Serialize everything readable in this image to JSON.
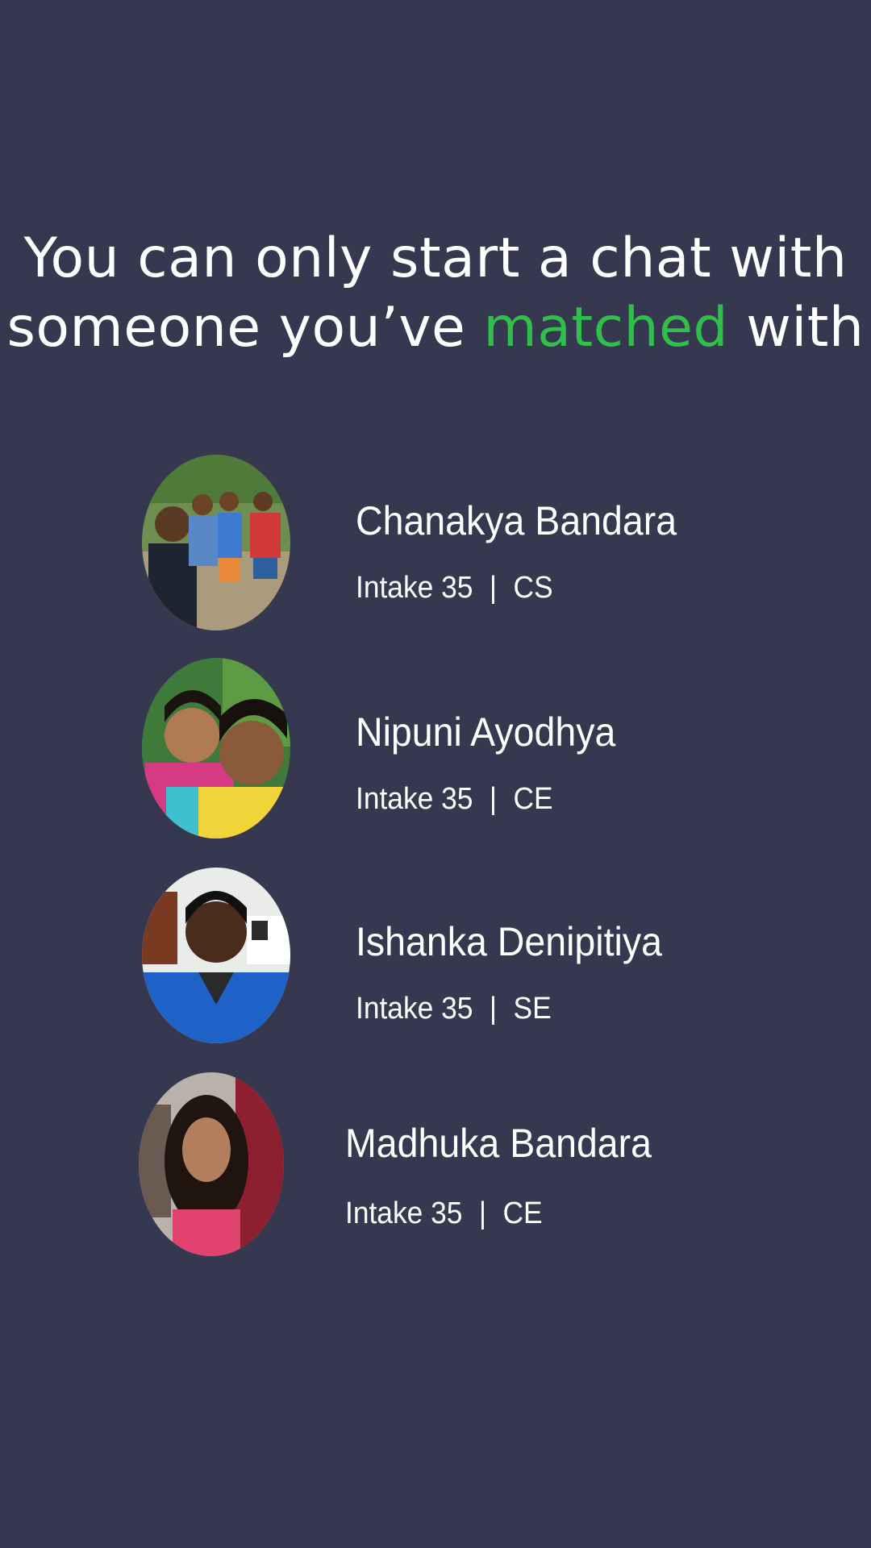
{
  "headline": {
    "line1": "You can only start a chat with",
    "line2_before": "someone you’ve",
    "line2_accent": "matched",
    "line2_after": "with"
  },
  "colors": {
    "background": "#363850",
    "accent": "#2fbf4a",
    "text": "#ffffff"
  },
  "matches": [
    {
      "name": "Chanakya Bandara",
      "intake": "Intake 35",
      "separator": "|",
      "department": "CS",
      "avatar": "group-selfie-photo"
    },
    {
      "name": "Nipuni Ayodhya",
      "intake": "Intake 35",
      "separator": "|",
      "department": "CE",
      "avatar": "two-friends-selfie-photo"
    },
    {
      "name": "Ishanka Denipitiya",
      "intake": "Intake 35",
      "separator": "|",
      "department": "SE",
      "avatar": "portrait-photo"
    },
    {
      "name": "Madhuka Bandara",
      "intake": "Intake 35",
      "separator": "|",
      "department": "CE",
      "avatar": "portrait-photo"
    }
  ]
}
